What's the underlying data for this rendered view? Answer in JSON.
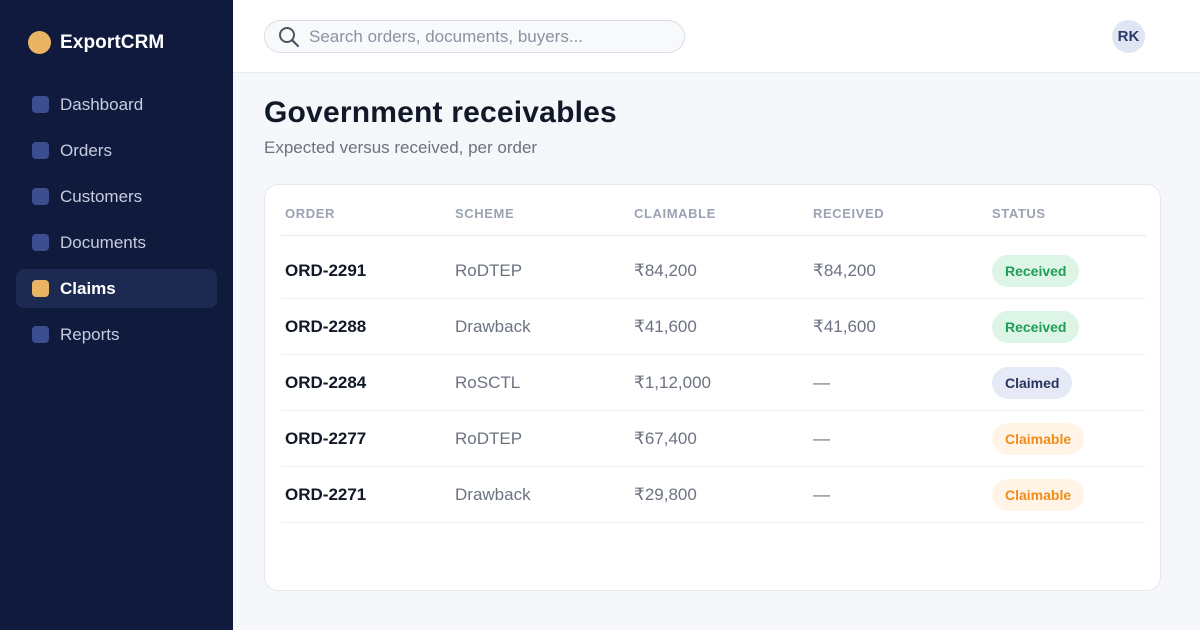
{
  "app": {
    "name": "ExportCRM",
    "brand_color": "#e9b463",
    "sidebar_color": "#101a3d"
  },
  "sidebar": {
    "items": [
      {
        "label": "Dashboard",
        "active": false
      },
      {
        "label": "Orders",
        "active": false
      },
      {
        "label": "Customers",
        "active": false
      },
      {
        "label": "Documents",
        "active": false
      },
      {
        "label": "Claims",
        "active": true
      },
      {
        "label": "Reports",
        "active": false
      }
    ]
  },
  "header": {
    "search": {
      "placeholder": "Search orders, documents, buyers...",
      "value": "",
      "icon": "search-icon"
    },
    "avatar": {
      "initials": "RK"
    }
  },
  "main": {
    "title": "Government receivables",
    "subtitle": "Expected versus received, per order",
    "table": {
      "columns": [
        "ORDER",
        "SCHEME",
        "CLAIMABLE",
        "RECEIVED",
        "STATUS"
      ],
      "rows": [
        {
          "order": "ORD-2291",
          "scheme": "RoDTEP",
          "claimable": "₹84,200",
          "received": "₹84,200",
          "status": "Received",
          "status_kind": "received"
        },
        {
          "order": "ORD-2288",
          "scheme": "Drawback",
          "claimable": "₹41,600",
          "received": "₹41,600",
          "status": "Received",
          "status_kind": "received"
        },
        {
          "order": "ORD-2284",
          "scheme": "RoSCTL",
          "claimable": "₹1,12,000",
          "received": "—",
          "status": "Claimed",
          "status_kind": "claimed"
        },
        {
          "order": "ORD-2277",
          "scheme": "RoDTEP",
          "claimable": "₹67,400",
          "received": "—",
          "status": "Claimable",
          "status_kind": "claimable"
        },
        {
          "order": "ORD-2271",
          "scheme": "Drawback",
          "claimable": "₹29,800",
          "received": "—",
          "status": "Claimable",
          "status_kind": "claimable"
        }
      ]
    }
  },
  "status_colors": {
    "received": "#1f9d55",
    "claimed": "#27345e",
    "claimable": "#f08c1a"
  }
}
